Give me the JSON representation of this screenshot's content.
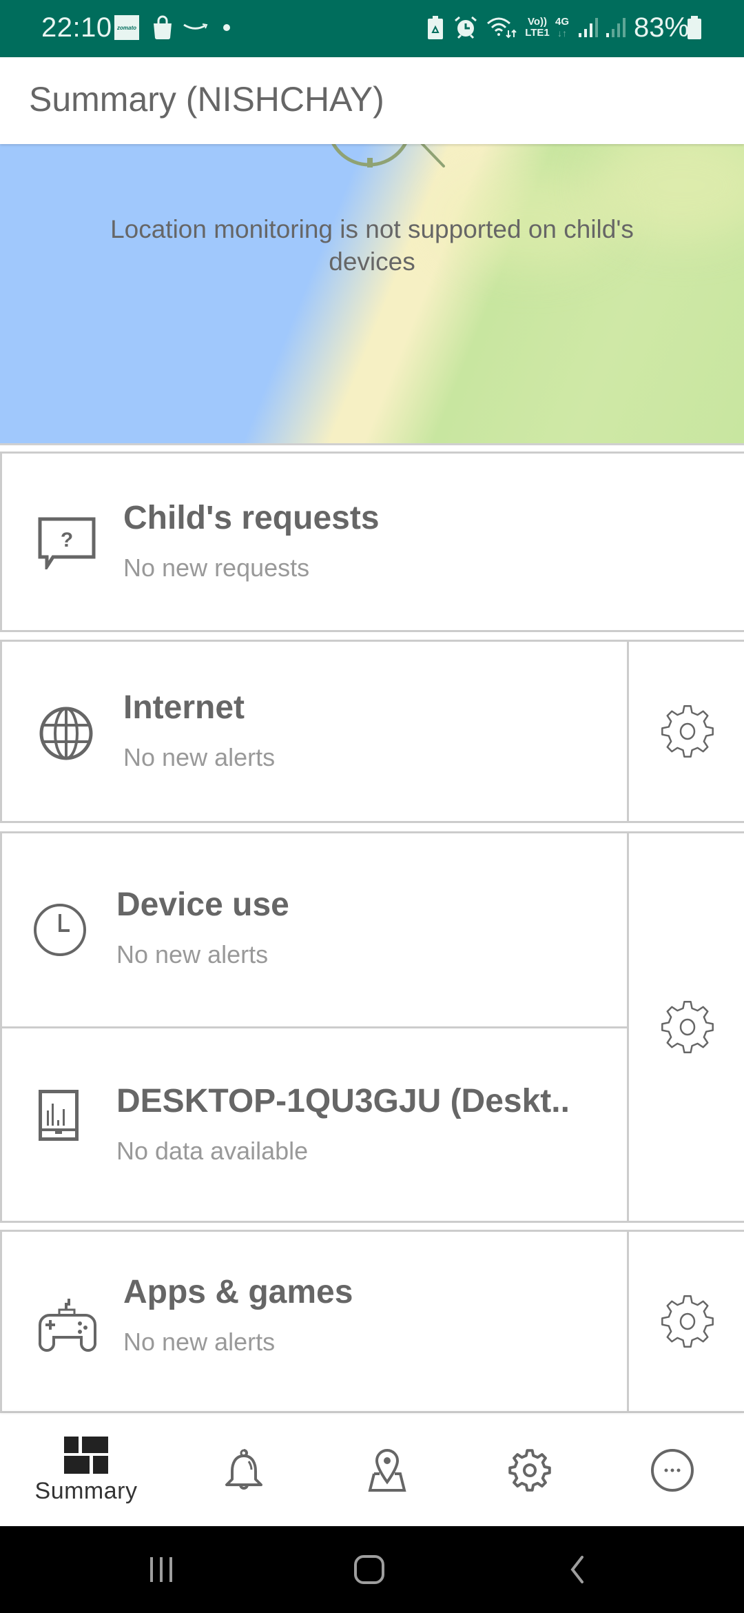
{
  "status_bar": {
    "time": "22:10",
    "notification_icons": [
      "zomato-icon",
      "shopping-bag-icon",
      "amazon-icon",
      "dot-icon"
    ],
    "zomato_label": "zomato",
    "system_icons": [
      "battery-saver-icon",
      "alarm-icon",
      "wifi-icon",
      "volte-icon",
      "4g-icon",
      "signal-icon",
      "signal-icon-2"
    ],
    "volte_top": "Vo))",
    "volte_bottom": "LTE1",
    "network_type": "4G",
    "battery_percent": "83%"
  },
  "app_bar": {
    "title": "Summary (NISHCHAY)"
  },
  "map": {
    "message": "Location monitoring is not supported on child's devices"
  },
  "cards": [
    {
      "id": "childs-requests",
      "icon": "question-bubble-icon",
      "title": "Child's requests",
      "subtitle": "No new requests",
      "has_settings": false
    },
    {
      "id": "internet",
      "icon": "globe-icon",
      "title": "Internet",
      "subtitle": "No new alerts",
      "has_settings": true
    },
    {
      "id": "device-use",
      "icon": "clock-icon",
      "title": "Device use",
      "subtitle": "No new alerts",
      "has_settings": true
    },
    {
      "id": "desktop-device",
      "icon": "device-chart-icon",
      "title": "DESKTOP-1QU3GJU (Deskt..",
      "subtitle": "No data available",
      "has_settings": true
    },
    {
      "id": "apps-games",
      "icon": "gamepad-icon",
      "title": "Apps & games",
      "subtitle": "No new alerts",
      "has_settings": true
    }
  ],
  "bottom_nav": {
    "items": [
      {
        "id": "summary",
        "icon": "summary-grid-icon",
        "label": "Summary",
        "active": true
      },
      {
        "id": "notifications",
        "icon": "bell-icon",
        "label": "",
        "active": false
      },
      {
        "id": "location",
        "icon": "map-pin-icon",
        "label": "",
        "active": false
      },
      {
        "id": "settings",
        "icon": "gear-icon",
        "label": "",
        "active": false
      },
      {
        "id": "more",
        "icon": "more-icon",
        "label": "",
        "active": false
      }
    ]
  },
  "system_nav": {
    "buttons": [
      "recent-apps",
      "home",
      "back"
    ]
  },
  "colors": {
    "status_bar": "#006d5c",
    "text_primary": "#666666",
    "text_secondary": "#999999",
    "border": "#cccccc",
    "map_water": "#a0c8fc",
    "map_land": "#c8e6a0",
    "map_sand": "#f6f0c4"
  }
}
